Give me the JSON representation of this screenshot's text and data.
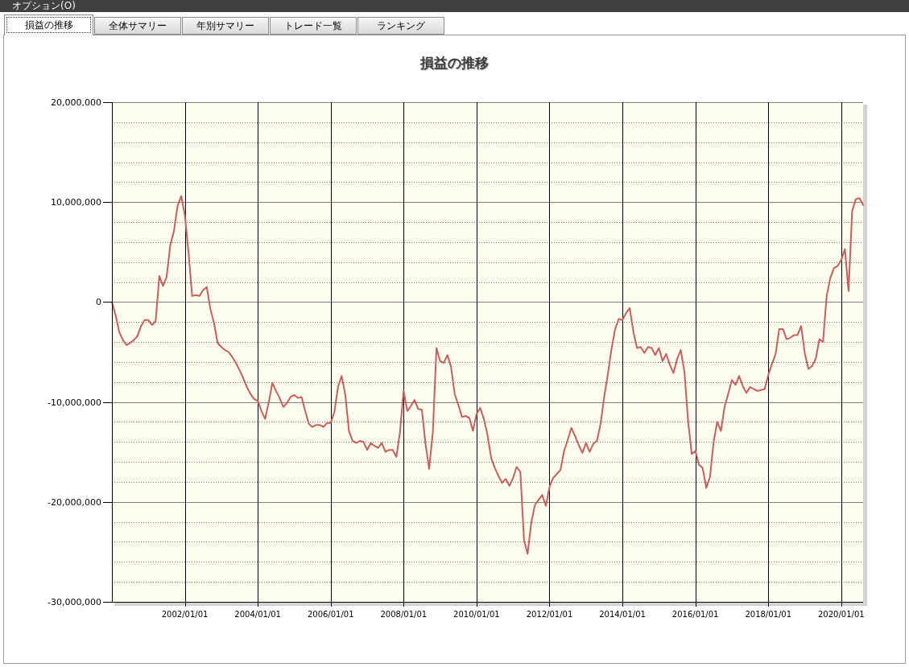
{
  "menu_bar": {
    "items": [
      "オプション(O)"
    ]
  },
  "tabs": [
    {
      "label": "損益の推移",
      "selected": true
    },
    {
      "label": "全体サマリー",
      "selected": false
    },
    {
      "label": "年別サマリー",
      "selected": false
    },
    {
      "label": "トレード一覧",
      "selected": false
    },
    {
      "label": "ランキング",
      "selected": false
    }
  ],
  "chart_panel": {
    "chart_data": {
      "type": "line",
      "title": "損益の推移",
      "grid": true,
      "categories": [
        null,
        null,
        null,
        null,
        null,
        null,
        null,
        null,
        null,
        null,
        null,
        null,
        null,
        null,
        null,
        null,
        null,
        null,
        null,
        null,
        "2002/01/01",
        null,
        null,
        null,
        null,
        null,
        null,
        null,
        null,
        null,
        null,
        null,
        null,
        null,
        null,
        null,
        null,
        null,
        null,
        null,
        "2004/01/01",
        null,
        null,
        null,
        null,
        null,
        null,
        null,
        null,
        null,
        null,
        null,
        null,
        null,
        null,
        null,
        null,
        null,
        null,
        null,
        "2006/01/01",
        null,
        null,
        null,
        null,
        null,
        null,
        null,
        null,
        null,
        null,
        null,
        null,
        null,
        null,
        null,
        null,
        null,
        null,
        null,
        "2008/01/01",
        null,
        null,
        null,
        null,
        null,
        null,
        null,
        null,
        null,
        null,
        null,
        null,
        null,
        null,
        null,
        null,
        null,
        null,
        null,
        "2010/01/01",
        null,
        null,
        null,
        null,
        null,
        null,
        null,
        null,
        null,
        null,
        null,
        null,
        null,
        null,
        null,
        null,
        null,
        null,
        null,
        "2012/01/01",
        null,
        null,
        null,
        null,
        null,
        null,
        null,
        null,
        null,
        null,
        null,
        null,
        null,
        null,
        null,
        null,
        null,
        null,
        null,
        "2014/01/01",
        null,
        null,
        null,
        null,
        null,
        null,
        null,
        null,
        null,
        null,
        null,
        null,
        null,
        null,
        null,
        null,
        null,
        null,
        null,
        "2016/01/01",
        null,
        null,
        null,
        null,
        null,
        null,
        null,
        null,
        null,
        null,
        null,
        null,
        null,
        null,
        null,
        null,
        null,
        null,
        null,
        "2018/01/01",
        null,
        null,
        null,
        null,
        null,
        null,
        null,
        null,
        null,
        null,
        null,
        null,
        null,
        null,
        null,
        null,
        null,
        null,
        null,
        "2020/01/01",
        null,
        null,
        null,
        null,
        null,
        null
      ],
      "values": [
        0,
        -1300000,
        -3000000,
        -3800000,
        -4300000,
        -4100000,
        -3800000,
        -3400000,
        -2400000,
        -1800000,
        -1800000,
        -2300000,
        -1900000,
        2600000,
        1600000,
        2500000,
        5700000,
        7100000,
        9600000,
        10600000,
        8700000,
        5000000,
        600000,
        700000,
        600000,
        1200000,
        1500000,
        -700000,
        -2100000,
        -4100000,
        -4500000,
        -4800000,
        -5000000,
        -5500000,
        -6100000,
        -6800000,
        -7600000,
        -8500000,
        -9200000,
        -9700000,
        -9900000,
        -10900000,
        -11700000,
        -10000000,
        -8100000,
        -8900000,
        -9600000,
        -10500000,
        -10100000,
        -9500000,
        -9300000,
        -9600000,
        -9500000,
        -10900000,
        -12200000,
        -12500000,
        -12300000,
        -12300000,
        -12500000,
        -12100000,
        -12100000,
        -11000000,
        -8500000,
        -7400000,
        -9300000,
        -12900000,
        -13900000,
        -14100000,
        -13900000,
        -14000000,
        -14800000,
        -14100000,
        -14400000,
        -14600000,
        -14100000,
        -15000000,
        -14800000,
        -14800000,
        -15500000,
        -13000000,
        -8900000,
        -10900000,
        -10400000,
        -9800000,
        -10700000,
        -10800000,
        -14200000,
        -16700000,
        -13000000,
        -4600000,
        -5900000,
        -6100000,
        -5300000,
        -6500000,
        -9200000,
        -10300000,
        -11500000,
        -11400000,
        -11600000,
        -12900000,
        -11200000,
        -10600000,
        -11700000,
        -13300000,
        -15600000,
        -16600000,
        -17400000,
        -18100000,
        -17700000,
        -18400000,
        -17600000,
        -16500000,
        -17000000,
        -23800000,
        -25200000,
        -22100000,
        -20300000,
        -19800000,
        -19300000,
        -20400000,
        -18500000,
        -17600000,
        -17200000,
        -16800000,
        -14900000,
        -13800000,
        -12600000,
        -13400000,
        -14300000,
        -15100000,
        -14100000,
        -15000000,
        -14200000,
        -13900000,
        -12200000,
        -9500000,
        -7200000,
        -4700000,
        -2700000,
        -1700000,
        -1800000,
        -1100000,
        -600000,
        -3000000,
        -4600000,
        -4500000,
        -5100000,
        -4500000,
        -4600000,
        -5300000,
        -4600000,
        -5900000,
        -5200000,
        -6300000,
        -7100000,
        -5700000,
        -4800000,
        -7000000,
        -11900000,
        -15200000,
        -14900000,
        -16300000,
        -16600000,
        -18600000,
        -17500000,
        -14000000,
        -12000000,
        -12900000,
        -10500000,
        -9200000,
        -7800000,
        -8300000,
        -7400000,
        -8400000,
        -9100000,
        -8500000,
        -8700000,
        -8900000,
        -8800000,
        -8700000,
        -7300000,
        -6200000,
        -5200000,
        -2700000,
        -2700000,
        -3700000,
        -3600000,
        -3300000,
        -3300000,
        -2400000,
        -5100000,
        -6700000,
        -6400000,
        -5700000,
        -3700000,
        -4000000,
        600000,
        2400000,
        3400000,
        3600000,
        4200000,
        5300000,
        1100000,
        9100000,
        10300000,
        10400000,
        9700000
      ],
      "ylim": [
        -30000000,
        20000000
      ],
      "yticks": [
        {
          "value": 20000000,
          "label": "20,000,000"
        },
        {
          "value": 10000000,
          "label": "10,000,000"
        },
        {
          "value": 0,
          "label": "0"
        },
        {
          "value": -10000000,
          "label": "-10,000,000"
        },
        {
          "value": -20000000,
          "label": "-20,000,000"
        },
        {
          "value": -30000000,
          "label": "-30,000,000"
        }
      ]
    }
  }
}
